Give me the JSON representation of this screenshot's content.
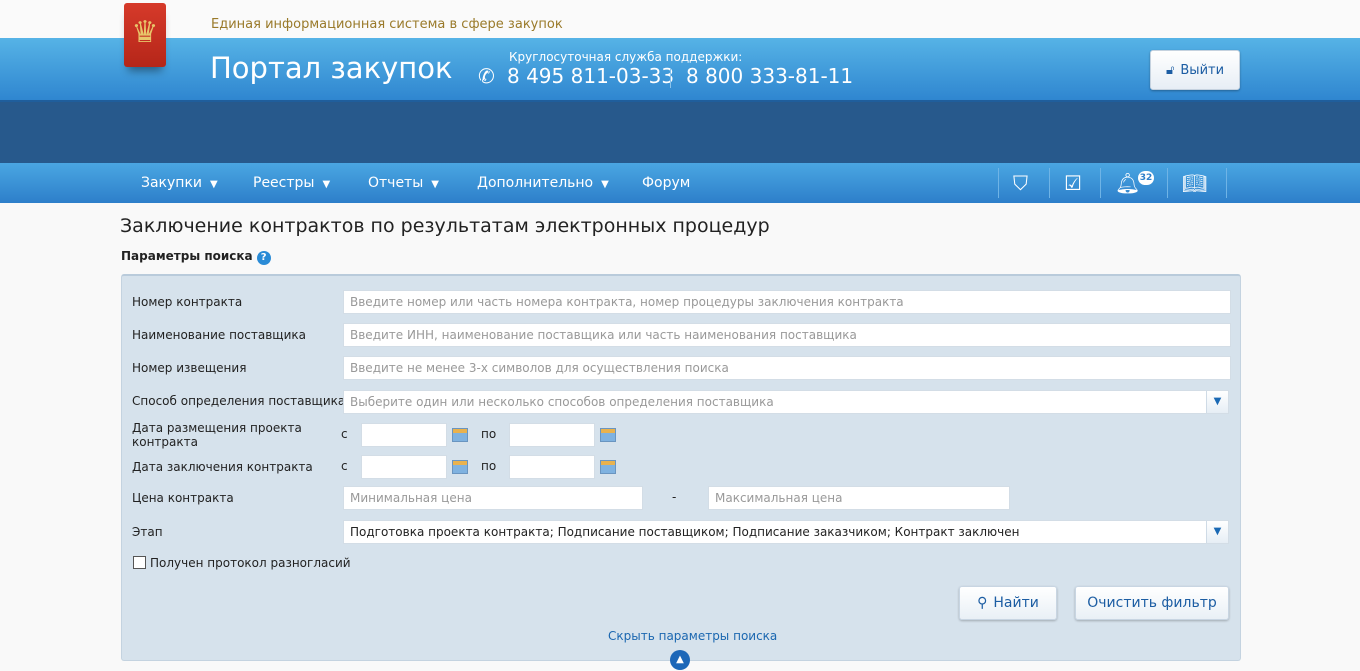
{
  "header": {
    "tagline": "Единая информационная система в сфере закупок",
    "portal_title": "Портал закупок",
    "support_label": "Круглосуточная служба поддержки:",
    "phone1": "8 495 811-03-33",
    "phone2": "8 800 333-81-11",
    "logout": "Выйти",
    "emblem_glyph": "♛"
  },
  "nav": {
    "items": [
      {
        "label": "Закупки",
        "caret": "▼"
      },
      {
        "label": "Реестры",
        "caret": "▼"
      },
      {
        "label": "Отчеты",
        "caret": "▼"
      },
      {
        "label": "Дополнительно",
        "caret": "▼"
      },
      {
        "label": "Форум"
      }
    ],
    "notification_count": "32"
  },
  "page": {
    "title": "Заключение контрактов по результатам электронных процедур",
    "params_label": "Параметры поиска",
    "help": "?"
  },
  "form": {
    "contract_number": {
      "label": "Номер контракта",
      "placeholder": "Введите номер или часть номера контракта, номер процедуры заключения контракта"
    },
    "supplier": {
      "label": "Наименование поставщика",
      "placeholder": "Введите ИНН, наименование поставщика или часть наименования поставщика"
    },
    "notice": {
      "label": "Номер извещения",
      "placeholder": "Введите не менее 3-х символов для осуществления поиска"
    },
    "method": {
      "label": "Способ определения поставщика",
      "placeholder": "Выберите один или несколько способов определения поставщика"
    },
    "placement_date": {
      "label": "Дата размещения проекта контракта",
      "from": "с",
      "to": "по"
    },
    "conclusion_date": {
      "label": "Дата заключения контракта",
      "from": "с",
      "to": "по"
    },
    "price": {
      "label": "Цена контракта",
      "min_placeholder": "Минимальная цена",
      "max_placeholder": "Максимальная цена",
      "dash": "-"
    },
    "stage": {
      "label": "Этап",
      "value": "Подготовка проекта контракта; Подписание поставщиком; Подписание заказчиком; Контракт заключен"
    },
    "protocol": {
      "label": "Получен протокол разногласий",
      "checked": false
    },
    "search_button": "Найти",
    "clear_button": "Очистить фильтр",
    "hide_link": "Скрыть параметры поиска"
  }
}
